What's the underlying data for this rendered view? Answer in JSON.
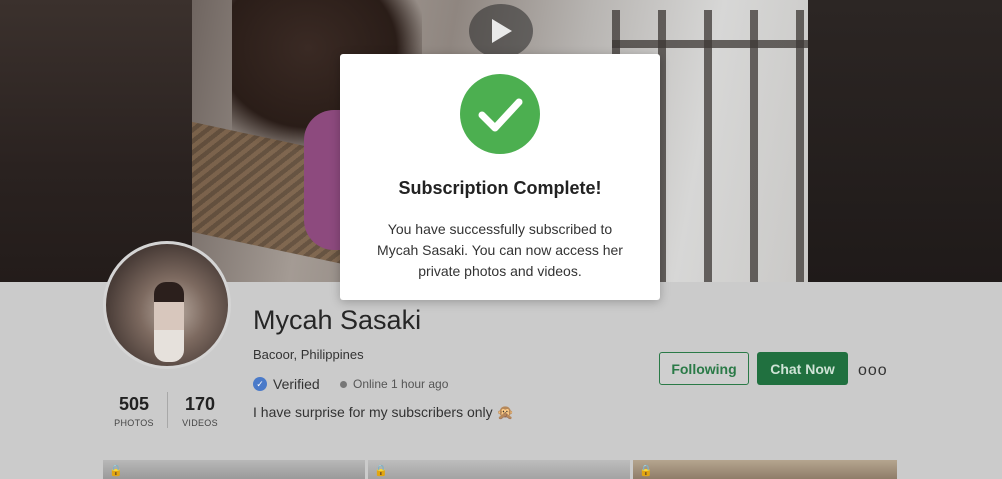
{
  "cover": {
    "play_icon": "play-icon"
  },
  "profile": {
    "name": "Mycah Sasaki",
    "location": "Bacoor, Philippines",
    "verified_label": "Verified",
    "online_status": "Online 1 hour ago",
    "bio": "I have surprise for my subscribers only 🙊",
    "stats": [
      {
        "value": "505",
        "label": "PHOTOS"
      },
      {
        "value": "170",
        "label": "VIDEOS"
      }
    ],
    "following_label": "Following",
    "chat_label": "Chat Now",
    "more_label": "ooo"
  },
  "modal": {
    "title": "Subscription Complete!",
    "message": "You have successfully subscribed to Mycah Sasaki. You can now access her private photos and videos.",
    "icon": "check-circle-icon"
  },
  "colors": {
    "success": "#4caf50",
    "brand_green": "#20703f",
    "verified_blue": "#4a7ac9"
  }
}
